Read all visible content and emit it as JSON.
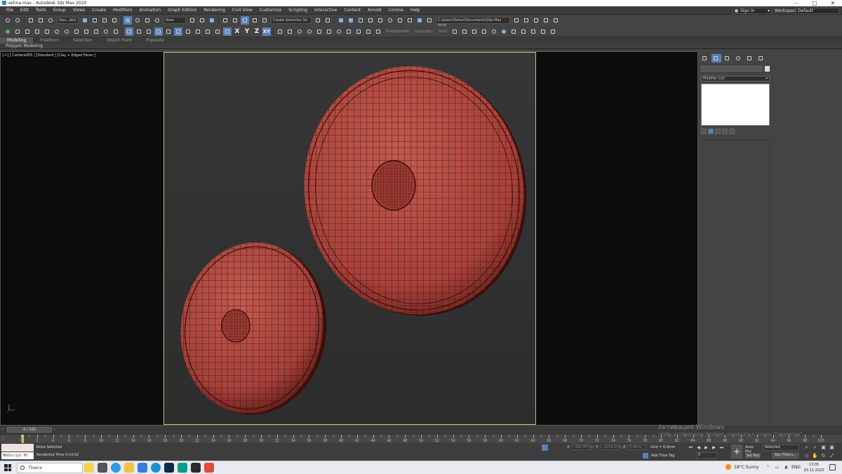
{
  "window": {
    "title": "sehna.max - Autodesk 3ds Max 2020"
  },
  "menu": {
    "items": [
      "File",
      "Edit",
      "Tools",
      "Group",
      "Views",
      "Create",
      "Modifiers",
      "Animation",
      "Graph Editors",
      "Rendering",
      "Civil View",
      "Customize",
      "Scripting",
      "Interactive",
      "Content",
      "Arnold",
      "Corona",
      "Help"
    ],
    "signin": "Sign In",
    "workspaces_label": "Workspaces:",
    "workspace": "Default"
  },
  "toolbar": {
    "geo_select": "Geo...ätry",
    "view_select": "View",
    "selection_set": "Create Selection Se",
    "project_path": "C:\\Users\\Temur\\Documents\\3ds Max 2020",
    "axis_x": "X",
    "axis_y": "Y",
    "axis_z": "Z",
    "axis_xy": "XY",
    "turbosmooth": "TurboSmooth",
    "symmetry": "Symmetry",
    "shell": "Shell"
  },
  "ribbon": {
    "tabs": [
      "Modeling",
      "Freeform",
      "Selection",
      "Object Paint",
      "Populate"
    ],
    "sub_label": "Polygon Modeling"
  },
  "viewport": {
    "label": "[+] [ Camera005 ] [Standard ] [Clay + Edged Faces ]",
    "mesh_color": "#a8423a"
  },
  "command_panel": {
    "modifier_list": "Modifier List"
  },
  "timeline": {
    "frame_display": "0 / 100",
    "ticks": [
      "0",
      "2",
      "4",
      "6",
      "8",
      "10",
      "12",
      "14",
      "16",
      "18",
      "20",
      "22",
      "24",
      "26",
      "28",
      "30",
      "32",
      "34",
      "36",
      "38",
      "40",
      "42",
      "44",
      "46",
      "48",
      "50",
      "52",
      "54",
      "56",
      "58",
      "60",
      "62",
      "64",
      "66",
      "68",
      "70",
      "72",
      "74",
      "76",
      "78",
      "80",
      "82",
      "84",
      "86",
      "88",
      "90",
      "92",
      "94",
      "96",
      "98",
      "100"
    ],
    "current_frame": 0
  },
  "status": {
    "maxscript": "MAXScript Mi",
    "selection": "None Selected",
    "render_time": "Rendering Time  0:14:02",
    "x_label": "X:",
    "x_value": "-160,97mm",
    "y_label": "Y:",
    "y_value": "-2219,21m",
    "z_label": "Z:",
    "z_value": "0,0mm",
    "grid": "Grid = 0,0mm",
    "add_time_tag": "Add Time Tag",
    "frame_field": "0",
    "auto_key": "Auto Key",
    "set_key": "Set Key",
    "selected_dd": "Selected",
    "key_filters": "Key Filters..."
  },
  "activation": {
    "title": "Активация Windows",
    "subtitle": "Чтобы активировать Windows, перейдите в раздел \"Параметры\"."
  },
  "taskbar": {
    "search": "Поиск",
    "temperature": "18°C  Sunny",
    "lang": "ENG",
    "time": "13:05",
    "date": "03.11.2023"
  }
}
